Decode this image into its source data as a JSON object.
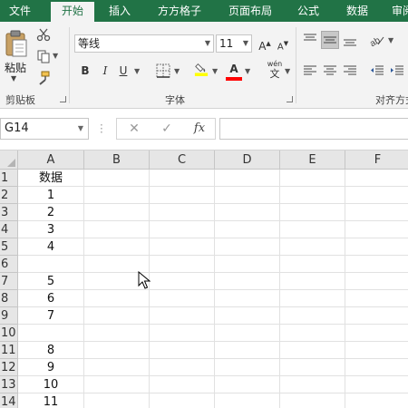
{
  "ribbon_tabs": [
    {
      "label": "文件",
      "active": false
    },
    {
      "label": "开始",
      "active": true
    },
    {
      "label": "插入",
      "active": false
    },
    {
      "label": "方方格子",
      "active": false
    },
    {
      "label": "页面布局",
      "active": false
    },
    {
      "label": "公式",
      "active": false
    },
    {
      "label": "数据",
      "active": false
    },
    {
      "label": "审阅",
      "active": false
    }
  ],
  "clipboard": {
    "paste_label": "粘贴",
    "group_label": "剪贴板"
  },
  "font": {
    "name": "等线",
    "size": "11",
    "group_label": "字体",
    "phonetic_label": "wén"
  },
  "alignment": {
    "group_label": "对齐方式"
  },
  "formula_bar": {
    "name_box": "G14",
    "fx_label": "fx",
    "formula": ""
  },
  "colors": {
    "brand": "#217346",
    "highlight": "#ffff00",
    "font_color": "#ff0000"
  },
  "sheet": {
    "columns": [
      "A",
      "B",
      "C",
      "D",
      "E",
      "F"
    ],
    "rows": [
      {
        "num": "1",
        "A": "数据"
      },
      {
        "num": "2",
        "A": "1"
      },
      {
        "num": "3",
        "A": "2"
      },
      {
        "num": "4",
        "A": "3"
      },
      {
        "num": "5",
        "A": "4"
      },
      {
        "num": "6",
        "A": ""
      },
      {
        "num": "7",
        "A": "5"
      },
      {
        "num": "8",
        "A": "6"
      },
      {
        "num": "9",
        "A": "7"
      },
      {
        "num": "10",
        "A": ""
      },
      {
        "num": "11",
        "A": "8"
      },
      {
        "num": "12",
        "A": "9"
      },
      {
        "num": "13",
        "A": "10"
      },
      {
        "num": "14",
        "A": "11"
      }
    ]
  }
}
